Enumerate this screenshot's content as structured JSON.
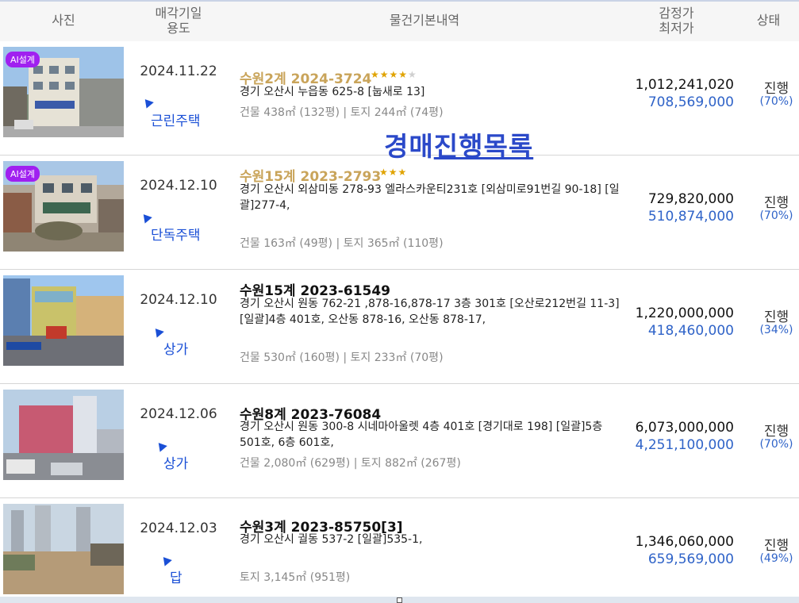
{
  "header": {
    "photo": "사진",
    "date_line1": "매각기일",
    "date_line2": "용도",
    "detail": "물건기본내역",
    "price_line1": "감정가",
    "price_line2": "최저가",
    "status": "상태"
  },
  "overlay_text_part1": "경매",
  "overlay_text_part2": "진행목록",
  "badge": "AI설계",
  "rows": [
    {
      "date": "2024.11.22",
      "usage": "근린주택",
      "case": "수원2계 2024-3724",
      "stars_on": "★★★★",
      "stars_off": "★",
      "addr": "경기 오산시 누읍동 625-8 [눕새로 13]",
      "area": "건물 438㎡ (132평)   |   토지 244㎡ (74평)",
      "appraisal": "1,012,241,020",
      "minimum": "708,569,000",
      "status": "진행",
      "pct": "(70%)"
    },
    {
      "date": "2024.12.10",
      "usage": "단독주택",
      "case": "수원15계 2023-2793",
      "stars_on": "★★★",
      "stars_off": "",
      "addr": "경기 오산시 외삼미동 278-93 엘라스카운티231호 [외삼미로91번길 90-18]  [일괄]277-4,",
      "area": "건물 163㎡ (49평)   |   토지 365㎡ (110평)",
      "appraisal": "729,820,000",
      "minimum": "510,874,000",
      "status": "진행",
      "pct": "(70%)"
    },
    {
      "date": "2024.12.10",
      "usage": "상가",
      "case": "수원15계 2023-61549",
      "addr": "경기 오산시 원동 762-21 ,878-16,878-17 3층 301호 [오산로212번길 11-3]  [일괄]4층 401호, 오산동 878-16, 오산동 878-17,",
      "area": "건물 530㎡ (160평)   |   토지 233㎡ (70평)",
      "appraisal": "1,220,000,000",
      "minimum": "418,460,000",
      "status": "진행",
      "pct": "(34%)"
    },
    {
      "date": "2024.12.06",
      "usage": "상가",
      "case": "수원8계 2023-76084",
      "addr": "경기 오산시 원동 300-8 시네마아울렛 4층 401호 [경기대로 198]  [일괄]5층 501호, 6층 601호,",
      "area": "건물 2,080㎡ (629평)   |   토지 882㎡ (267평)",
      "appraisal": "6,073,000,000",
      "minimum": "4,251,100,000",
      "status": "진행",
      "pct": "(70%)"
    },
    {
      "date": "2024.12.03",
      "usage": "답",
      "case": "수원3계 2023-85750[3]",
      "addr": "경기 오산시 궐동 537-2  [일괄]535-1,",
      "area": "토지 3,145㎡ (951평)",
      "appraisal": "1,346,060,000",
      "minimum": "659,569,000",
      "status": "진행",
      "pct": "(49%)"
    }
  ]
}
